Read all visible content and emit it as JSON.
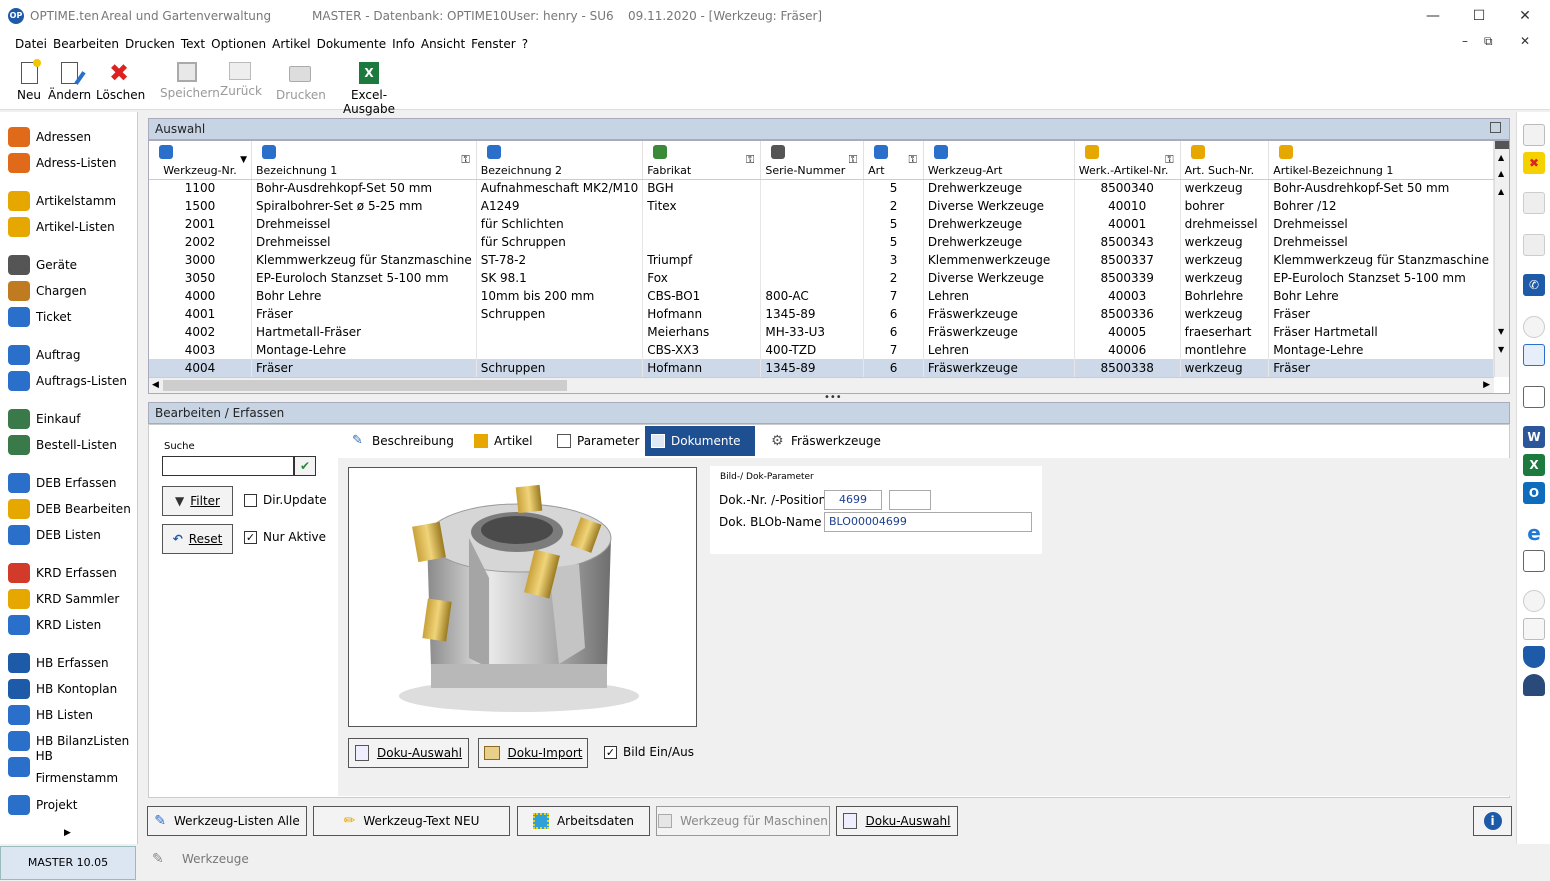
{
  "titlebar": {
    "app": "OPTIME.ten",
    "module": "Areal und Gartenverwaltung",
    "db": "MASTER - Datenbank: OPTIME10",
    "user": "User: henry - SU6",
    "context": "09.11.2020 - [Werkzeug: Fräser]",
    "logo": "OP"
  },
  "menu": [
    "Datei",
    "Bearbeiten",
    "Drucken",
    "Text",
    "Optionen",
    "Artikel",
    "Dokumente",
    "Info",
    "Ansicht",
    "Fenster",
    "?"
  ],
  "toolbar": {
    "neu": "Neu",
    "aendern": "Ändern",
    "loeschen": "Löschen",
    "speichern": "Speichern",
    "zurueck": "Zurück",
    "drucken": "Drucken",
    "excel": "Excel-Ausgabe"
  },
  "sidebar": [
    "Adressen",
    "Adress-Listen",
    "Artikelstamm",
    "Artikel-Listen",
    "Geräte",
    "Chargen",
    "Ticket",
    "Auftrag",
    "Auftrags-Listen",
    "Einkauf",
    "Bestell-Listen",
    "DEB Erfassen",
    "DEB Bearbeiten",
    "DEB Listen",
    "KRD Erfassen",
    "KRD Sammler",
    "KRD Listen",
    "HB Erfassen",
    "HB Kontoplan",
    "HB Listen",
    "HB BilanzListen",
    "HB Firmenstamm",
    "Projekt"
  ],
  "status": {
    "left": "MASTER  10.05",
    "bottom": "Werkzeuge"
  },
  "auswahl": {
    "title": "Auswahl",
    "columns": [
      "Werkzeug-Nr.",
      "Bezeichnung 1",
      "Bezeichnung 2",
      "Fabrikat",
      "Serie-Nummer",
      "Art",
      "Werkzeug-Art",
      "Werk.-Artikel-Nr.",
      "Art. Such-Nr.",
      "Artikel-Bezeichnung 1"
    ],
    "rows": [
      [
        "1100",
        "Bohr-Ausdrehkopf-Set 50 mm",
        "Aufnahmeschaft MK2/M10",
        "BGH",
        "",
        "5",
        "Drehwerkzeuge",
        "8500340",
        "werkzeug",
        "Bohr-Ausdrehkopf-Set 50 mm"
      ],
      [
        "1500",
        "Spiralbohrer-Set ø 5-25 mm",
        "A1249",
        "Titex",
        "",
        "2",
        "Diverse Werkzeuge",
        "40010",
        "bohrer",
        "Bohrer /12"
      ],
      [
        "2001",
        "Drehmeissel",
        "für Schlichten",
        "",
        "",
        "5",
        "Drehwerkzeuge",
        "40001",
        "drehmeissel",
        "Drehmeissel"
      ],
      [
        "2002",
        "Drehmeissel",
        "für Schruppen",
        "",
        "",
        "5",
        "Drehwerkzeuge",
        "8500343",
        "werkzeug",
        "Drehmeissel"
      ],
      [
        "3000",
        "Klemmwerkzeug für Stanzmaschine",
        "ST-78-2",
        "Triumpf",
        "",
        "3",
        "Klemmenwerkzeuge",
        "8500337",
        "werkzeug",
        "Klemmwerkzeug für Stanzmaschine"
      ],
      [
        "3050",
        "EP-Euroloch Stanzset 5-100 mm",
        "SK 98.1",
        "Fox",
        "",
        "2",
        "Diverse Werkzeuge",
        "8500339",
        "werkzeug",
        "EP-Euroloch Stanzset 5-100 mm"
      ],
      [
        "4000",
        "Bohr Lehre",
        "10mm bis 200 mm",
        "CBS-BO1",
        "800-AC",
        "7",
        "Lehren",
        "40003",
        "Bohrlehre",
        "Bohr Lehre"
      ],
      [
        "4001",
        "Fräser",
        "Schruppen",
        "Hofmann",
        "1345-89",
        "6",
        "Fräswerkzeuge",
        "8500336",
        "werkzeug",
        "Fräser"
      ],
      [
        "4002",
        "Hartmetall-Fräser",
        "",
        "Meierhans",
        "MH-33-U3",
        "6",
        "Fräswerkzeuge",
        "40005",
        "fraeserhart",
        "Fräser Hartmetall"
      ],
      [
        "4003",
        "Montage-Lehre",
        "",
        "CBS-XX3",
        "400-TZD",
        "7",
        "Lehren",
        "40006",
        "montlehre",
        "Montage-Lehre"
      ],
      [
        "4004",
        "Fräser",
        "Schruppen",
        "Hofmann",
        "1345-89",
        "6",
        "Fräswerkzeuge",
        "8500338",
        "werkzeug",
        "Fräser"
      ]
    ]
  },
  "bearbeiten": {
    "title": "Bearbeiten / Erfassen",
    "suche_label": "Suche",
    "suche_value": "",
    "filter": "Filter",
    "reset": "Reset",
    "dirupdate": "Dir.Update",
    "nuraktive": "Nur Aktive"
  },
  "tabs": [
    "Beschreibung",
    "Artikel",
    "Parameter",
    "Dokumente",
    "Fräswerkzeuge"
  ],
  "dok": {
    "group": "Bild-/ Dok-Parameter",
    "nr_label": "Dok.-Nr. /-Position",
    "nr_value": "4699",
    "pos_value": "",
    "blob_label": "Dok. BLOb-Name",
    "blob_value": "BLO00004699",
    "doku_auswahl": "Doku-Auswahl",
    "doku_import": "Doku-Import",
    "bild": "Bild Ein/Aus"
  },
  "bottom": {
    "b1": "Werkzeug-Listen Alle",
    "b2": "Werkzeug-Text NEU",
    "b3": "Arbeitsdaten",
    "b4": "Werkzeug für Maschinen",
    "b5": "Doku-Auswahl"
  }
}
